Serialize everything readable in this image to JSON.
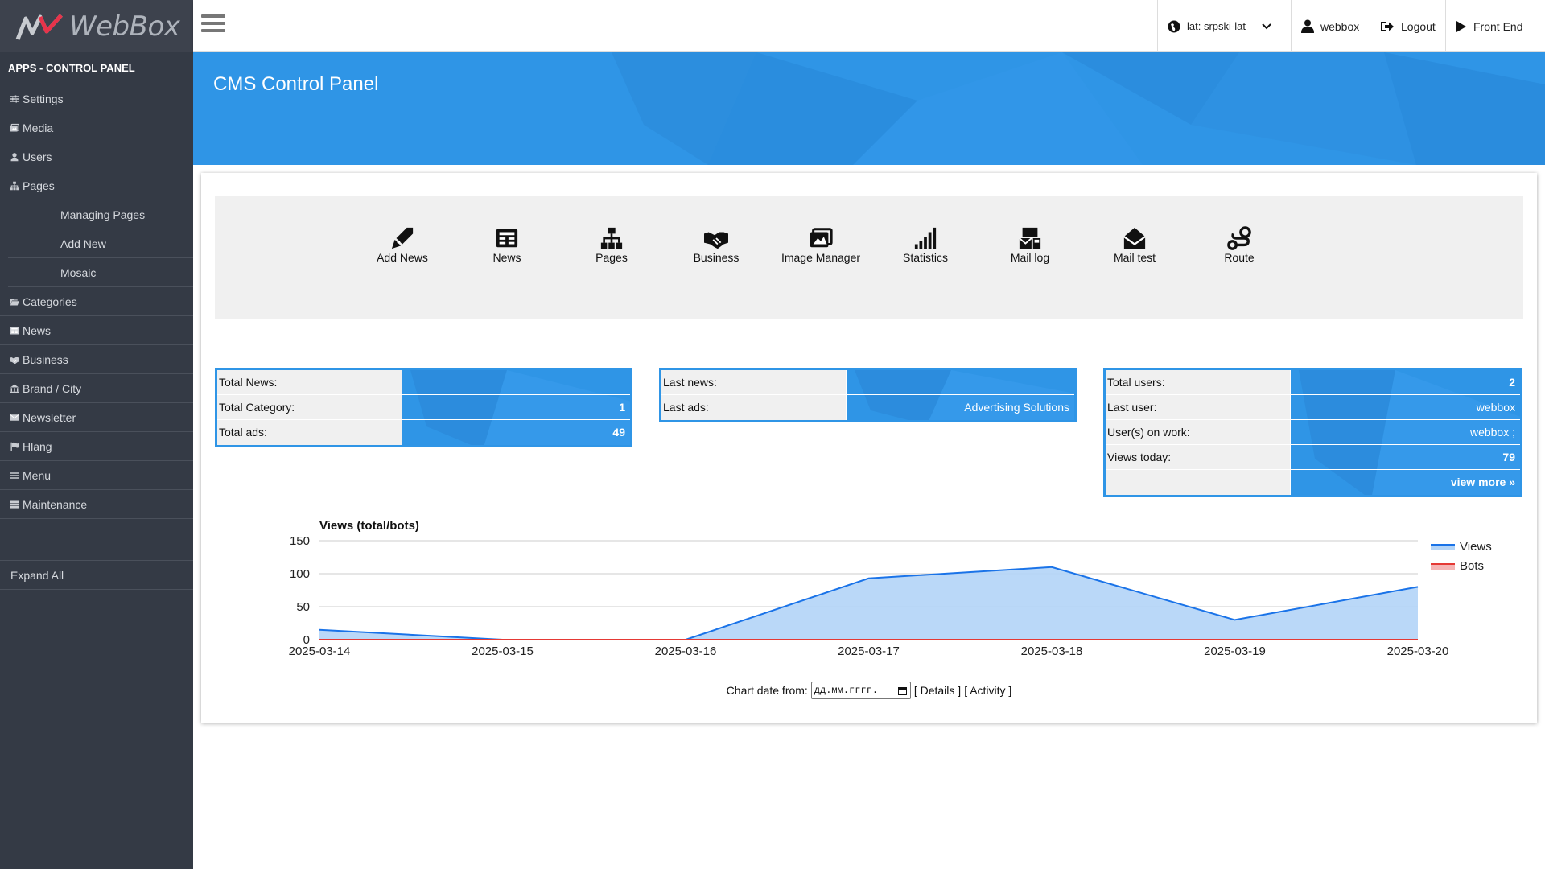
{
  "app": {
    "logo_text": "WebBox"
  },
  "sidebar": {
    "title": "APPS - CONTROL PANEL",
    "items": [
      {
        "label": "Settings",
        "icon": "sliders-icon"
      },
      {
        "label": "Media",
        "icon": "images-icon"
      },
      {
        "label": "Users",
        "icon": "user-icon"
      },
      {
        "label": "Pages",
        "icon": "sitemap-icon"
      },
      {
        "label": "Managing Pages",
        "sub": true
      },
      {
        "label": "Add New",
        "sub": true
      },
      {
        "label": "Mosaic",
        "sub": true
      },
      {
        "label": "Categories",
        "icon": "folder-open-icon"
      },
      {
        "label": "News",
        "icon": "newspaper-icon"
      },
      {
        "label": "Business",
        "icon": "handshake-icon"
      },
      {
        "label": "Brand / City",
        "icon": "building-icon"
      },
      {
        "label": "Newsletter",
        "icon": "envelope-icon"
      },
      {
        "label": "Hlang",
        "icon": "flag-icon"
      },
      {
        "label": "Menu",
        "icon": "bars-icon"
      },
      {
        "label": "Maintenance",
        "icon": "database-icon"
      }
    ],
    "expand_all": "Expand All"
  },
  "topbar": {
    "language": "lat: srpski-lat",
    "user": "webbox",
    "logout": "Logout",
    "front_end": "Front End"
  },
  "page": {
    "title": "CMS Control Panel"
  },
  "shortcuts": [
    {
      "label": "Add News",
      "icon": "pen-nib-icon"
    },
    {
      "label": "News",
      "icon": "newspaper-icon"
    },
    {
      "label": "Pages",
      "icon": "sitemap-icon"
    },
    {
      "label": "Business",
      "icon": "handshake-icon"
    },
    {
      "label": "Image Manager",
      "icon": "images-icon"
    },
    {
      "label": "Statistics",
      "icon": "signal-icon"
    },
    {
      "label": "Mail log",
      "icon": "mail-bulk-icon"
    },
    {
      "label": "Mail test",
      "icon": "envelope-open-icon"
    },
    {
      "label": "Route",
      "icon": "route-icon"
    }
  ],
  "stats_content": {
    "total_news_label": "Total News:",
    "total_news_value": "",
    "total_category_label": "Total Category:",
    "total_category_value": "1",
    "total_ads_label": "Total ads:",
    "total_ads_value": "49"
  },
  "stats_latest": {
    "last_news_label": "Last news:",
    "last_news_value": "",
    "last_ads_label": "Last ads:",
    "last_ads_value": "Advertising Solutions"
  },
  "stats_users": {
    "total_users_label": "Total users:",
    "total_users_value": "2",
    "last_user_label": "Last user:",
    "last_user_value": "webbox",
    "users_on_work_label": "User(s) on work:",
    "users_on_work_value": "webbox ;",
    "views_today_label": "Views today:",
    "views_today_value": "79",
    "view_more": "view more »"
  },
  "chart_data": {
    "type": "area",
    "title": "Views (total/bots)",
    "categories": [
      "2025-03-14",
      "2025-03-15",
      "2025-03-16",
      "2025-03-17",
      "2025-03-18",
      "2025-03-19",
      "2025-03-20"
    ],
    "series": [
      {
        "name": "Views",
        "values": [
          15,
          0,
          0,
          93,
          110,
          30,
          80
        ],
        "color": "#1a73e8",
        "fill": "#b3d4f7"
      },
      {
        "name": "Bots",
        "values": [
          0,
          0,
          0,
          0,
          0,
          0,
          0
        ],
        "color": "#e53935",
        "fill": "#f5b5b5"
      }
    ],
    "yticks": [
      0,
      50,
      100,
      150
    ],
    "ylim": [
      0,
      150
    ],
    "grid": true,
    "legend": "right"
  },
  "chart_controls": {
    "date_label": "Chart date from:",
    "date_placeholder": "дд.мм.гггг.",
    "details": "[ Details ]",
    "activity": "[ Activity ]"
  }
}
